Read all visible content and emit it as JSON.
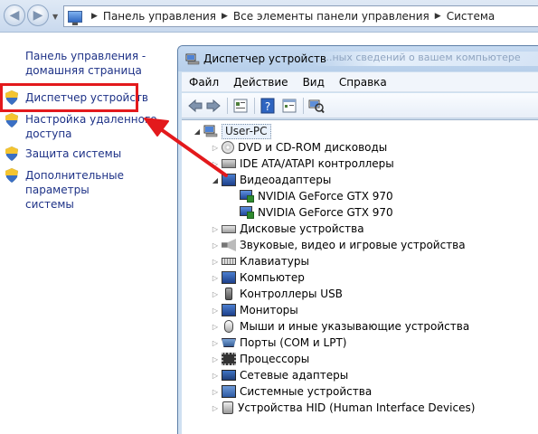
{
  "address_bar": {
    "breadcrumbs": [
      "Панель управления",
      "Все элементы панели управления",
      "Система"
    ]
  },
  "left_pane": {
    "links": [
      {
        "label_lines": [
          "Панель управления -",
          "домашняя страница"
        ],
        "has_shield": false
      },
      {
        "label_lines": [
          "Диспетчер устройств"
        ],
        "has_shield": true
      },
      {
        "label_lines": [
          "Настройка удаленного",
          "доступа"
        ],
        "has_shield": true
      },
      {
        "label_lines": [
          "Защита системы"
        ],
        "has_shield": true
      },
      {
        "label_lines": [
          "Дополнительные параметры",
          "системы"
        ],
        "has_shield": true
      }
    ],
    "link_color": "#1e3287",
    "highlight_color": "#e3191c"
  },
  "device_manager": {
    "title": "Диспетчер устройств",
    "background_title_fragment": "...ных сведений о вашем компьютере",
    "menu": [
      "Файл",
      "Действие",
      "Вид",
      "Справка"
    ],
    "toolbar_icons": [
      "back-arrow-icon",
      "forward-arrow-icon",
      "properties-icon",
      "help-icon",
      "view-icon",
      "scan-hardware-icon"
    ],
    "tree": {
      "root": "User-PC",
      "categories": [
        {
          "label": "DVD и CD-ROM дисководы",
          "icon": "disk-icon",
          "expanded": false,
          "children": []
        },
        {
          "label": "IDE ATA/ATAPI контроллеры",
          "icon": "ide-icon",
          "expanded": false,
          "children": []
        },
        {
          "label": "Видеоадаптеры",
          "icon": "monitor-icon",
          "expanded": true,
          "children": [
            "NVIDIA GeForce GTX 970",
            "NVIDIA GeForce GTX 970"
          ]
        },
        {
          "label": "Дисковые устройства",
          "icon": "hdd-icon",
          "expanded": false,
          "children": []
        },
        {
          "label": "Звуковые, видео и игровые устройства",
          "icon": "sound-icon",
          "expanded": false,
          "children": []
        },
        {
          "label": "Клавиатуры",
          "icon": "keyboard-icon",
          "expanded": false,
          "children": []
        },
        {
          "label": "Компьютер",
          "icon": "computer-icon",
          "expanded": false,
          "children": []
        },
        {
          "label": "Контроллеры USB",
          "icon": "usb-icon",
          "expanded": false,
          "children": []
        },
        {
          "label": "Мониторы",
          "icon": "monitor-icon",
          "expanded": false,
          "children": []
        },
        {
          "label": "Мыши и иные указывающие устройства",
          "icon": "mouse-icon",
          "expanded": false,
          "children": []
        },
        {
          "label": "Порты (COM и LPT)",
          "icon": "port-icon",
          "expanded": false,
          "children": []
        },
        {
          "label": "Процессоры",
          "icon": "cpu-icon",
          "expanded": false,
          "children": []
        },
        {
          "label": "Сетевые адаптеры",
          "icon": "network-icon",
          "expanded": false,
          "children": []
        },
        {
          "label": "Системные устройства",
          "icon": "system-icon",
          "expanded": false,
          "children": []
        },
        {
          "label": "Устройства HID (Human Interface Devices)",
          "icon": "hid-icon",
          "expanded": false,
          "children": []
        }
      ]
    }
  },
  "annotation": {
    "arrow_color": "#e3191c"
  }
}
